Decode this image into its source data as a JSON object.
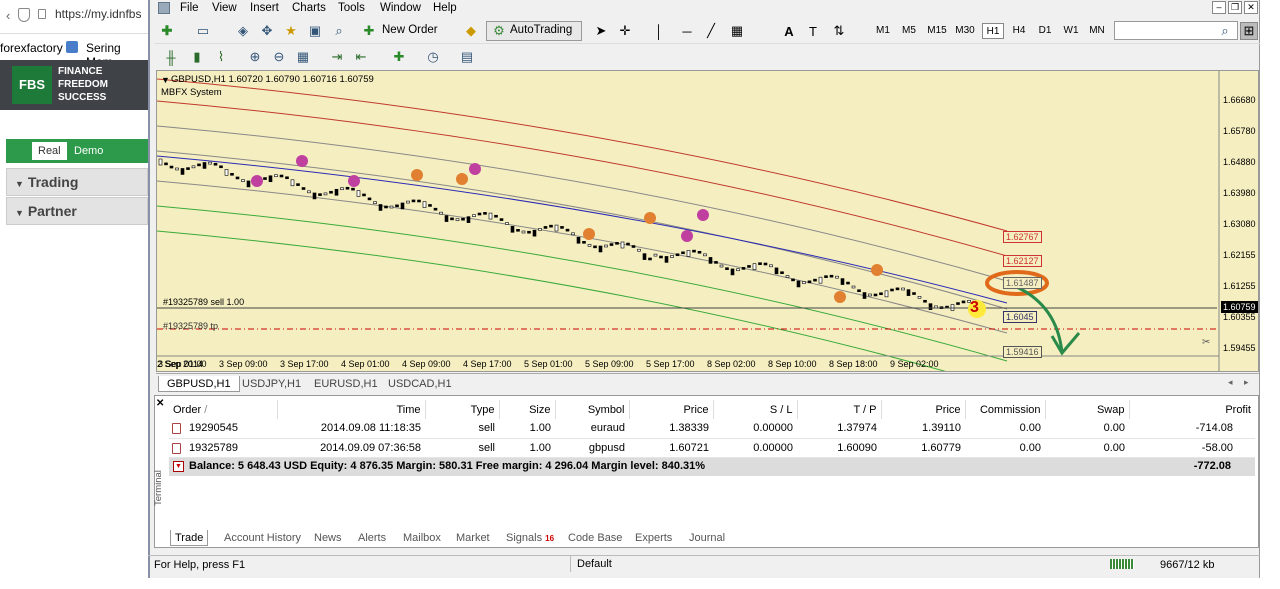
{
  "browser": {
    "url": "https://my.idnfbs",
    "bookmark1": "forexfactory",
    "bookmark2": "Sering Mam",
    "logo_lines": [
      "FINANCE",
      "FREEDOM",
      "SUCCESS"
    ],
    "logo_badge": "FBS",
    "tab_real": "Real",
    "tab_demo": "Demo",
    "nav_trading": "Trading",
    "nav_partner": "Partner"
  },
  "menu": [
    "File",
    "View",
    "Insert",
    "Charts",
    "Tools",
    "Window",
    "Help"
  ],
  "toolbar": {
    "new_order": "New Order",
    "autotrading": "AutoTrading",
    "timeframes": [
      "M1",
      "M5",
      "M15",
      "M30",
      "H1",
      "H4",
      "D1",
      "W1",
      "MN"
    ],
    "active_tf": "H1"
  },
  "chart": {
    "symbol_line": "GBPUSD,H1  1.60720 1.60790 1.60716 1.60759",
    "indicator": "MBFX System",
    "price_labels": [
      "1.66680",
      "1.65780",
      "1.64880",
      "1.63980",
      "1.63080",
      "1.62155",
      "1.61255",
      "1.60355",
      "1.59455"
    ],
    "current_price": "1.60759",
    "time_labels": [
      "2 Sep 2014",
      "3 Sep 01:00",
      "3 Sep 09:00",
      "3 Sep 17:00",
      "4 Sep 01:00",
      "4 Sep 09:00",
      "4 Sep 17:00",
      "5 Sep 01:00",
      "5 Sep 09:00",
      "5 Sep 17:00",
      "8 Sep 02:00",
      "8 Sep 10:00",
      "8 Sep 18:00",
      "9 Sep 02:00"
    ],
    "line_sell": "#19325789 sell 1.00",
    "line_tp": "#19325789 tp",
    "level_labels": [
      "1.62767",
      "1.62127",
      "1.61487",
      "1.6045",
      "1.59416"
    ],
    "annotation": "3"
  },
  "chart_tabs": [
    "GBPUSD,H1",
    "USDJPY,H1",
    "EURUSD,H1",
    "USDCAD,H1"
  ],
  "terminal": {
    "columns": [
      "Order",
      "Time",
      "Type",
      "Size",
      "Symbol",
      "Price",
      "S / L",
      "T / P",
      "Price",
      "Commission",
      "Swap",
      "Profit"
    ],
    "rows": [
      [
        "19290545",
        "2014.09.08 11:18:35",
        "sell",
        "1.00",
        "euraud",
        "1.38339",
        "0.00000",
        "1.37974",
        "1.39110",
        "0.00",
        "0.00",
        "-714.08"
      ],
      [
        "19325789",
        "2014.09.09 07:36:58",
        "sell",
        "1.00",
        "gbpusd",
        "1.60721",
        "0.00000",
        "1.60090",
        "1.60779",
        "0.00",
        "0.00",
        "-58.00"
      ]
    ],
    "summary": "Balance: 5 648.43 USD  Equity: 4 876.35  Margin: 580.31  Free margin: 4 296.04  Margin level: 840.31%",
    "total": "-772.08",
    "side_label": "Terminal",
    "tabs": [
      "Trade",
      "Account History",
      "News",
      "Alerts",
      "Mailbox",
      "Market",
      "Signals",
      "Code Base",
      "Experts",
      "Journal"
    ],
    "signals_count": "16"
  },
  "status": {
    "help": "For Help, press F1",
    "profile": "Default",
    "traffic": "9667/12 kb"
  }
}
